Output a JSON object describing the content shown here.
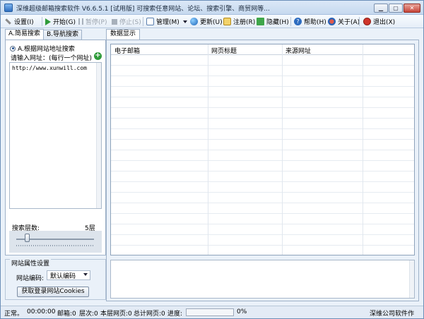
{
  "window": {
    "title": "深维超级邮箱搜索软件 V6.6.5.1 [试用版] 可搜索任意网站、论坛、搜索引擎、商贸网等..."
  },
  "toolbar": {
    "settings": "设置(I)",
    "start": "开始(G)",
    "pause": "暂停(P)",
    "stop": "停止(S)",
    "manage": "管理(M)",
    "update": "更新(U)",
    "register": "注册(R)",
    "hide": "隐藏(H)",
    "help": "帮助(H)",
    "about": "关于(A)",
    "exit": "退出(X)"
  },
  "left": {
    "tabs": [
      "A.简易搜索",
      "B.导航搜索"
    ],
    "radio_label": "A.根据网站地址搜索",
    "input_label": "请输入网址：(每行一个网址)",
    "url_value": "http://www.xunwill.com",
    "depth_label": "搜索层数:",
    "depth_value": "5层",
    "depth_level": 1,
    "group_title": "网站属性设置",
    "encoding_label": "网站编码:",
    "encoding_value": "默认编码",
    "cookie_button": "获取登录网站Cookies"
  },
  "right": {
    "tab": "数据显示",
    "columns": [
      "电子邮箱",
      "网页标题",
      "来源网址"
    ]
  },
  "status": {
    "state": "正常。",
    "time": "00:00:00",
    "mailbox": "邮箱:0",
    "level": "层次:0",
    "page_current": "本层网页:0",
    "page_total": "总计网页:0",
    "progress_label": "进度:",
    "progress_percent": "0%",
    "progress_value": 0,
    "company": "深维公司软件作"
  }
}
